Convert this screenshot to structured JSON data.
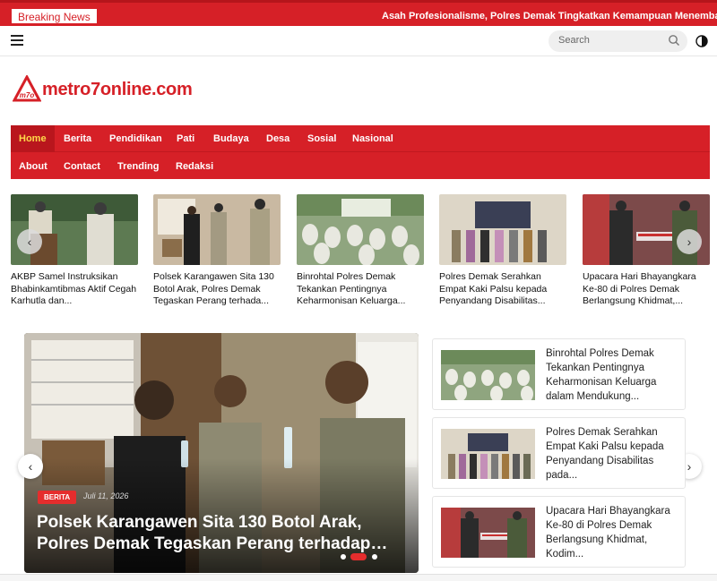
{
  "breaking": {
    "label": "Breaking News",
    "ticker": "Asah Profesionalisme, Polres Demak Tingkatkan Kemampuan Menembak"
  },
  "search": {
    "placeholder": "Search"
  },
  "logo": {
    "text": "metro7online.com",
    "mark": "m7o"
  },
  "menu": {
    "row1": [
      "Home",
      "Berita",
      "Pendidikan",
      "Pati",
      "Budaya",
      "Desa",
      "Sosial",
      "Nasional"
    ],
    "row2": [
      "About",
      "Contact",
      "Trending",
      "Redaksi"
    ]
  },
  "carousel": {
    "items": [
      {
        "title": "AKBP Samel Instruksikan Bhabinkamtibmas Aktif Cegah Karhutla dan..."
      },
      {
        "title": "Polsek Karangawen Sita 130 Botol Arak, Polres Demak Tegaskan Perang terhada..."
      },
      {
        "title": "Binrohtal Polres Demak Tekankan Pentingnya Keharmonisan Keluarga..."
      },
      {
        "title": "Polres Demak Serahkan Empat Kaki Palsu kepada Penyandang Disabilitas..."
      },
      {
        "title": "Upacara Hari Bhayangkara Ke-80 di Polres Demak Berlangsung Khidmat,..."
      }
    ]
  },
  "featured": {
    "category": "BERITA",
    "date": "Juli 11, 2026",
    "headline": "Polsek Karangawen Sita 130 Botol Arak, Polres Demak Tegaskan Perang terhadap…"
  },
  "side_list": [
    {
      "title": "Binrohtal Polres Demak Tekankan Pentingnya Keharmonisan Keluarga dalam Mendukung..."
    },
    {
      "title": "Polres Demak Serahkan Empat Kaki Palsu kepada Penyandang Disabilitas pada..."
    },
    {
      "title": "Upacara Hari Bhayangkara Ke-80 di Polres Demak Berlangsung Khidmat, Kodim..."
    }
  ],
  "icons": {
    "prev": "‹",
    "next": "›"
  },
  "colors": {
    "brand_red": "#d62027",
    "active_menu": "#ffd94a"
  }
}
